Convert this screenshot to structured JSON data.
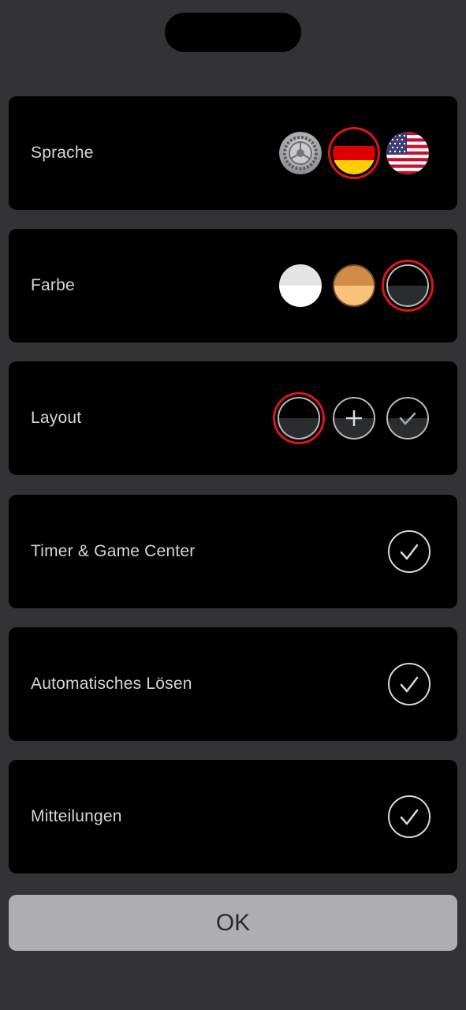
{
  "settings": {
    "language": {
      "label": "Sprache",
      "options": [
        "system-settings-icon",
        "german-flag-icon",
        "us-flag-icon"
      ],
      "selected": "german-flag-icon"
    },
    "color": {
      "label": "Farbe",
      "options": [
        "light-theme",
        "orange-theme",
        "dark-theme"
      ],
      "selected": "dark-theme"
    },
    "layout": {
      "label": "Layout",
      "options": [
        "dark-layout",
        "plus-layout",
        "check-layout"
      ],
      "selected": "dark-layout"
    },
    "timer": {
      "label": "Timer & Game Center",
      "enabled": true
    },
    "auto_solve": {
      "label": "Automatisches Lösen",
      "enabled": true
    },
    "notifications": {
      "label": "Mitteilungen",
      "enabled": true
    }
  },
  "ok_button": {
    "label": "OK"
  },
  "colors": {
    "selection_ring": "#e01616",
    "card_background": "#000000",
    "page_background": "#333335",
    "ok_background": "#aeaeb0"
  }
}
